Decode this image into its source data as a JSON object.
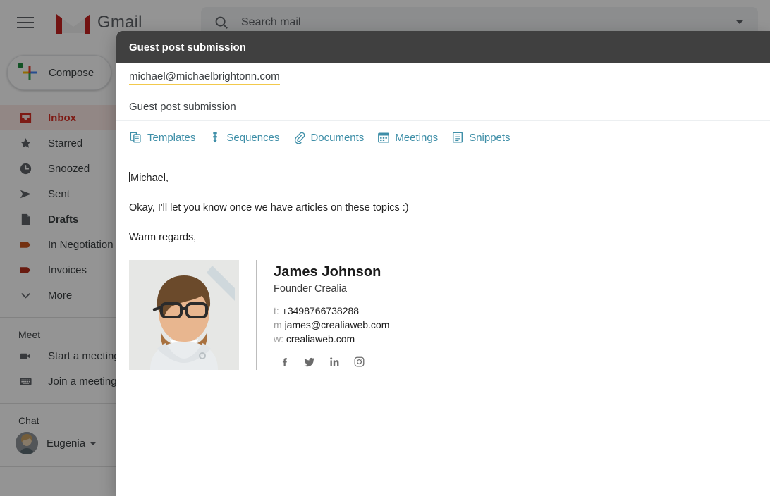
{
  "app": {
    "brand": "Gmail",
    "menu_icon": "hamburger-icon",
    "logo_icon": "gmail-logo-icon"
  },
  "search": {
    "placeholder": "Search mail",
    "icon": "search-icon",
    "options_icon": "chevron-down-icon"
  },
  "sidebar": {
    "compose_label": "Compose",
    "compose_icon": "plus-icon",
    "items": [
      {
        "label": "Inbox",
        "icon": "inbox-icon",
        "active": true,
        "bold": true
      },
      {
        "label": "Starred",
        "icon": "star-icon",
        "active": false,
        "bold": false
      },
      {
        "label": "Snoozed",
        "icon": "clock-icon",
        "active": false,
        "bold": false
      },
      {
        "label": "Sent",
        "icon": "send-icon",
        "active": false,
        "bold": false
      },
      {
        "label": "Drafts",
        "icon": "draft-file-icon",
        "active": false,
        "bold": true
      },
      {
        "label": "In Negotiation",
        "icon": "label-tag-icon",
        "color": "#c8551e",
        "active": false,
        "bold": false
      },
      {
        "label": "Invoices",
        "icon": "label-tag-icon",
        "color": "#b5301c",
        "active": false,
        "bold": false
      },
      {
        "label": "More",
        "icon": "chevron-down-icon",
        "active": false,
        "bold": false
      }
    ],
    "meet": {
      "title": "Meet",
      "items": [
        {
          "label": "Start a meeting",
          "icon": "video-camera-icon"
        },
        {
          "label": "Join a meeting",
          "icon": "keyboard-icon"
        }
      ]
    },
    "chat": {
      "title": "Chat",
      "user": "Eugenia",
      "status_color": "#1e8e3e",
      "caret_icon": "chevron-down-icon",
      "avatar_icon": "avatar"
    }
  },
  "compose": {
    "window_title": "Guest post submission",
    "to": "michael@michaelbrightonn.com",
    "to_underline_color": "#f2c94c",
    "subject": "Guest post submission",
    "plugin_bar": [
      {
        "label": "Templates",
        "icon": "templates-copy-icon"
      },
      {
        "label": "Sequences",
        "icon": "sequences-arrow-icon"
      },
      {
        "label": "Documents",
        "icon": "paperclip-icon"
      },
      {
        "label": "Meetings",
        "icon": "calendar-icon"
      },
      {
        "label": "Snippets",
        "icon": "snippet-note-icon"
      }
    ],
    "plugin_color": "#3f8fa8",
    "body": [
      "Michael,",
      "Okay, I'll let you know once we have articles on these topics :)",
      "Warm regards,"
    ],
    "signature": {
      "photo_alt": "portrait-photo",
      "name": "James Johnson",
      "role": "Founder Crealia",
      "contacts": [
        {
          "prefix": "t:",
          "value": "+3498766738288"
        },
        {
          "prefix": "m",
          "value": "james@crealiaweb.com"
        },
        {
          "prefix": "w:",
          "value": "crealiaweb.com"
        }
      ],
      "social": [
        {
          "name": "facebook-icon"
        },
        {
          "name": "twitter-icon"
        },
        {
          "name": "linkedin-icon"
        },
        {
          "name": "instagram-icon"
        }
      ]
    }
  }
}
